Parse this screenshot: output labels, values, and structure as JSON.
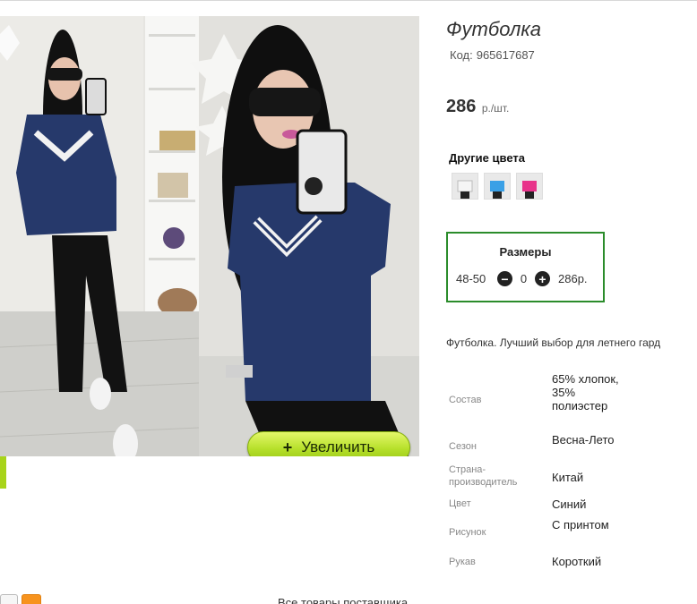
{
  "product": {
    "title": "Футболка",
    "sku_label": "Код:",
    "sku_value": "965617687",
    "price_value": "286",
    "price_unit": "р./шт."
  },
  "colors": {
    "title": "Другие цвета",
    "swatches": [
      {
        "name": "white",
        "color": "#f1f1f1"
      },
      {
        "name": "light-blue",
        "color": "#3aa0e6"
      },
      {
        "name": "pink",
        "color": "#e8338a"
      }
    ]
  },
  "sizes": {
    "title": "Размеры",
    "rows": [
      {
        "size": "48-50",
        "quantity": "0",
        "price": "286р."
      }
    ]
  },
  "zoom_button": {
    "icon": "plus-icon",
    "label": "Увеличить"
  },
  "description": "Футболка. Лучший выбор для летнего гард",
  "attributes": [
    {
      "name": "Состав",
      "value": "65% хлопок, 35% полиэстер"
    },
    {
      "name": "Сезон",
      "value": "Весна-Лето"
    },
    {
      "name": "Страна-производитель",
      "value": "Китай"
    },
    {
      "name": "Цвет",
      "value": "Синий"
    },
    {
      "name": "Рисунок",
      "value": "С принтом"
    },
    {
      "name": "Рукав",
      "value": "Короткий"
    }
  ],
  "footer_text": "Все товары поставщика",
  "palette": {
    "accent_green": "#2b8c2b",
    "button_green": "#b6e02a",
    "tshirt_navy": "#26396b"
  }
}
